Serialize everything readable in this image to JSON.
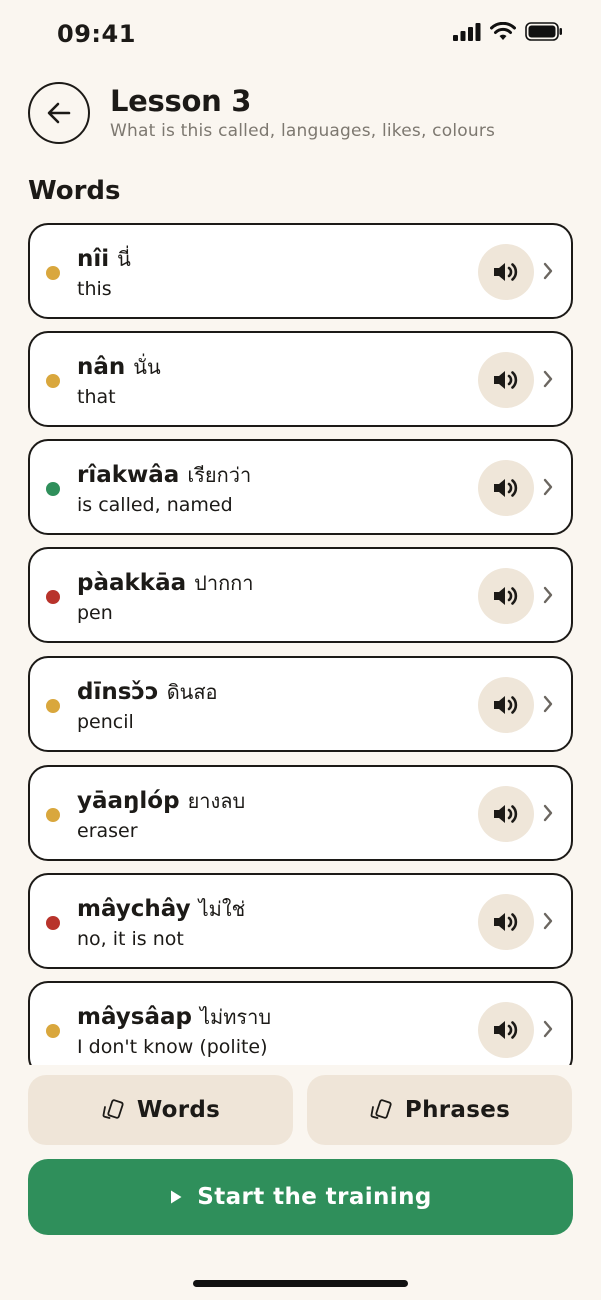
{
  "status_bar": {
    "time": "09:41"
  },
  "header": {
    "title": "Lesson 3",
    "subtitle": "What is this called, languages, likes, colours"
  },
  "words_section": {
    "title": "Words"
  },
  "colors": {
    "yellow": "#d9a73d",
    "green": "#2f8f5b",
    "red": "#b8332b",
    "accent_green": "#2f8f5b",
    "chip_bg": "#efe6d9"
  },
  "words": [
    {
      "translit": "nîi",
      "thai": "นี่",
      "meaning": "this",
      "status": "yellow",
      "dot_color": "#d9a73d"
    },
    {
      "translit": "nân",
      "thai": "นั่น",
      "meaning": "that",
      "status": "yellow",
      "dot_color": "#d9a73d"
    },
    {
      "translit": "rîakwâa",
      "thai": "เรียกว่า",
      "meaning": "is called, named",
      "status": "green",
      "dot_color": "#2f8f5b"
    },
    {
      "translit": "pàakkāa",
      "thai": "ปากกา",
      "meaning": "pen",
      "status": "red",
      "dot_color": "#b8332b"
    },
    {
      "translit": "dīnsɔ̌ɔ",
      "thai": "ดินสอ",
      "meaning": "pencil",
      "status": "yellow",
      "dot_color": "#d9a73d"
    },
    {
      "translit": "yāaŋlóp",
      "thai": "ยางลบ",
      "meaning": "eraser",
      "status": "yellow",
      "dot_color": "#d9a73d"
    },
    {
      "translit": "mâychây",
      "thai": "ไม่ใช่",
      "meaning": "no, it is not",
      "status": "red",
      "dot_color": "#b8332b"
    },
    {
      "translit": "mâysâap",
      "thai": "ไม่ทราบ",
      "meaning": "I don't know (polite)",
      "status": "yellow",
      "dot_color": "#d9a73d"
    }
  ],
  "tabs": {
    "words_label": "Words",
    "phrases_label": "Phrases"
  },
  "start_button": {
    "label": "Start the training"
  },
  "icons": {
    "back": "arrow-left-icon",
    "speaker": "speaker-icon",
    "chevron": "chevron-right-icon",
    "cards": "flashcards-icon",
    "play": "play-icon"
  }
}
